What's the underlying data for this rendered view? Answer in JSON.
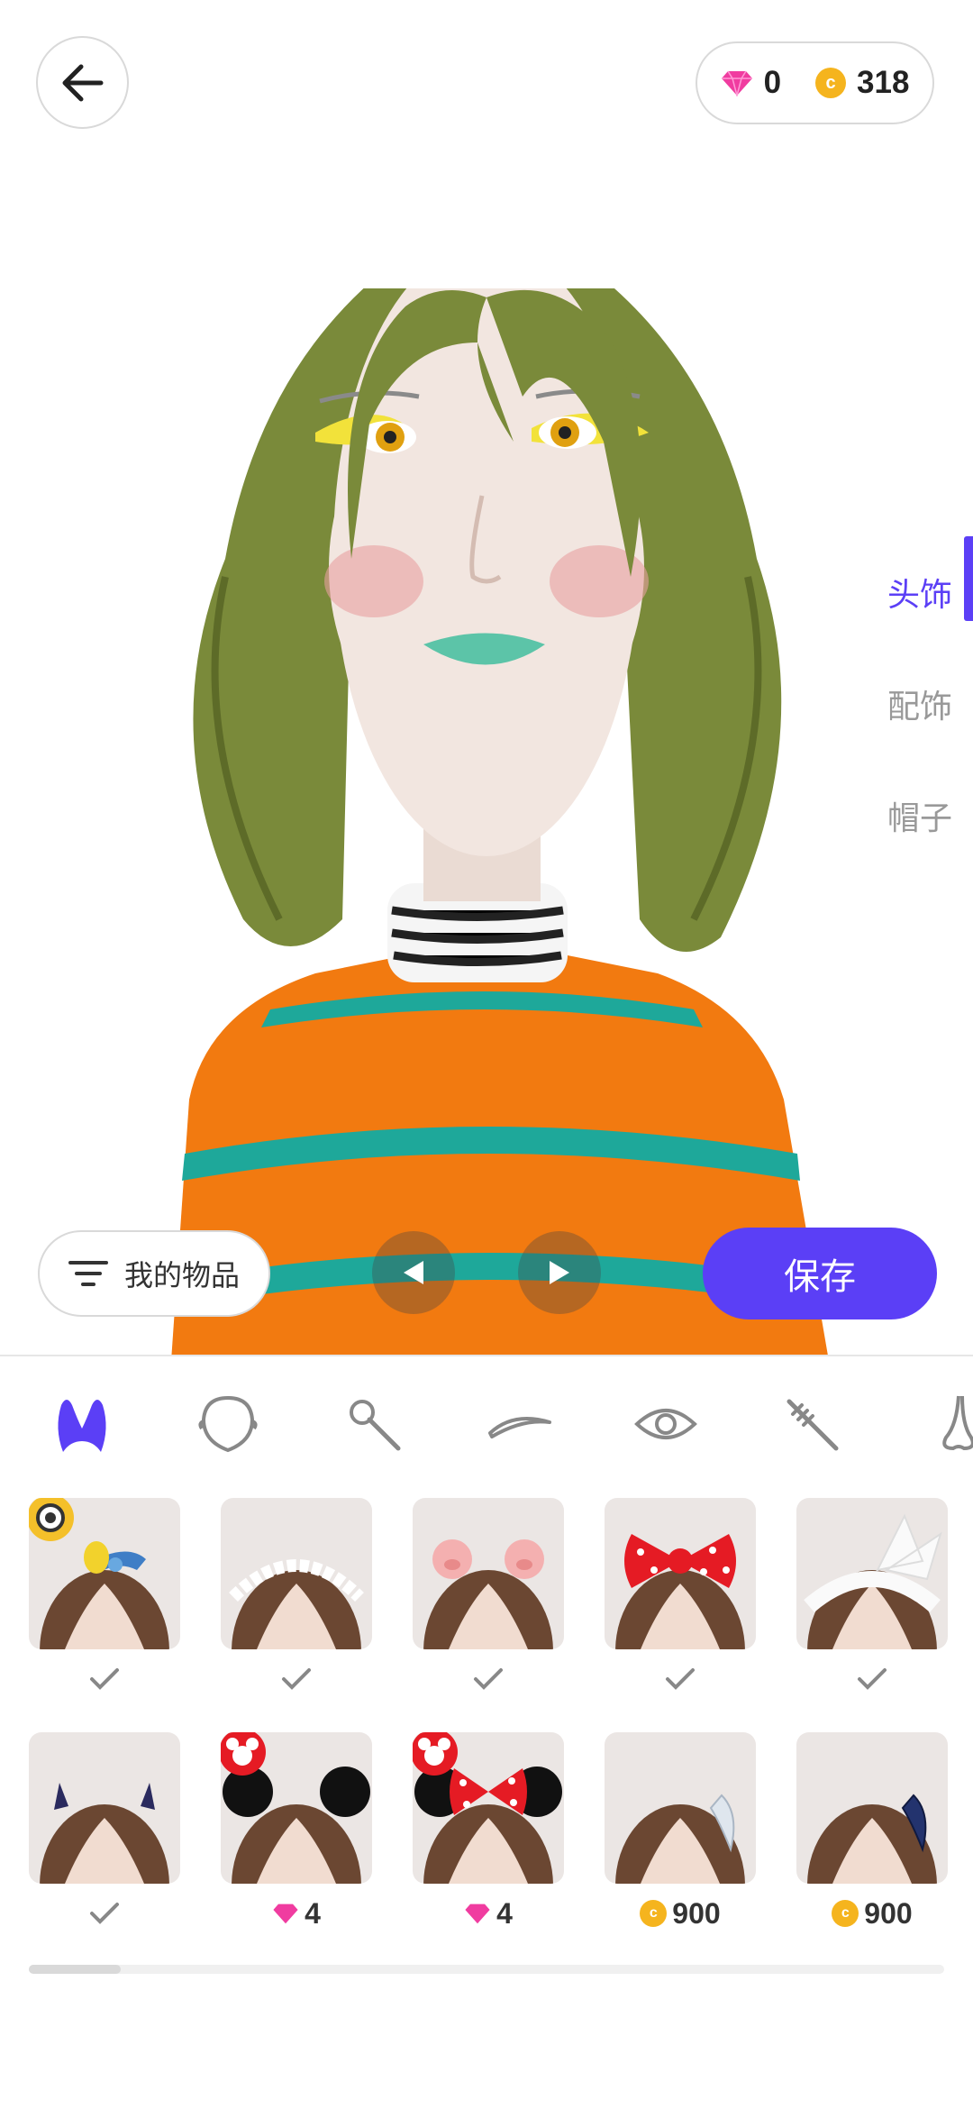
{
  "currency": {
    "gems": "0",
    "coins": "318",
    "gem_icon": "pink-diamond-icon",
    "coin_icon": "gold-coin-icon"
  },
  "side_menu": [
    {
      "label": "头饰",
      "active": true
    },
    {
      "label": "配饰",
      "active": false
    },
    {
      "label": "帽子",
      "active": false
    }
  ],
  "controls": {
    "my_items_label": "我的物品",
    "save_label": "保存"
  },
  "category_tabs": [
    {
      "icon": "bunny-ears-icon",
      "active": true
    },
    {
      "icon": "face-shape-icon",
      "active": false
    },
    {
      "icon": "makeup-brush-icon",
      "active": false
    },
    {
      "icon": "eyebrow-icon",
      "active": false
    },
    {
      "icon": "eye-icon",
      "active": false
    },
    {
      "icon": "mascara-wand-icon",
      "active": false
    },
    {
      "icon": "nose-icon",
      "active": false
    }
  ],
  "items": [
    {
      "name": "minion-bird-headpiece",
      "status": "owned",
      "price": ""
    },
    {
      "name": "maid-headband",
      "status": "owned",
      "price": ""
    },
    {
      "name": "pig-headband",
      "status": "owned",
      "price": ""
    },
    {
      "name": "red-polka-bow",
      "status": "owned",
      "price": ""
    },
    {
      "name": "white-bunny-bow",
      "status": "owned",
      "price": ""
    },
    {
      "name": "devil-horns",
      "status": "owned",
      "price": ""
    },
    {
      "name": "mickey-ears",
      "status": "gem",
      "price": "4"
    },
    {
      "name": "minnie-ears-bow",
      "status": "gem",
      "price": "4"
    },
    {
      "name": "white-feather-clip",
      "status": "coin",
      "price": "900"
    },
    {
      "name": "blue-feather-clip",
      "status": "coin",
      "price": "900"
    }
  ],
  "colors": {
    "accent": "#5b3ff6",
    "gem": "#f03ca0",
    "coin": "#f5b41e"
  }
}
